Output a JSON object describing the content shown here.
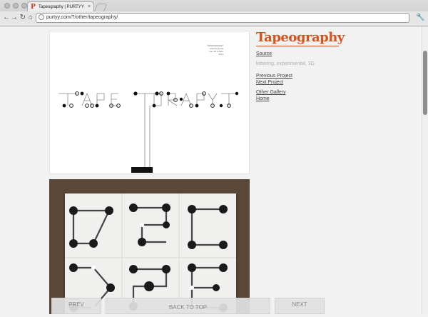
{
  "browser": {
    "tab_title": "Tapeography | PURTYY",
    "favicon_glyph": "P",
    "close_glyph": "×",
    "url": "purtyy.com/?/other/tapeography/",
    "back_glyph": "←",
    "forward_glyph": "→",
    "reload_glyph": "↻",
    "home_glyph": "⌂",
    "menu_glyph": "🔧"
  },
  "project": {
    "title": "Tapeography",
    "source_label": "Source",
    "tags": "lettering, experimental, 3D",
    "previous_project": "Previous Project",
    "next_project": "Next Project",
    "other_gallery": "Other Gallery",
    "home": "Home",
    "accent_color": "#d9531e"
  },
  "poster": {
    "credit_lines": [
      "TAPEOGRAPHY",
      "lettering study",
      "one roll of tape",
      "2011"
    ]
  },
  "pager": {
    "prev": "PREV",
    "back_to_top": "BACK TO TOP",
    "next": "NEXT"
  }
}
